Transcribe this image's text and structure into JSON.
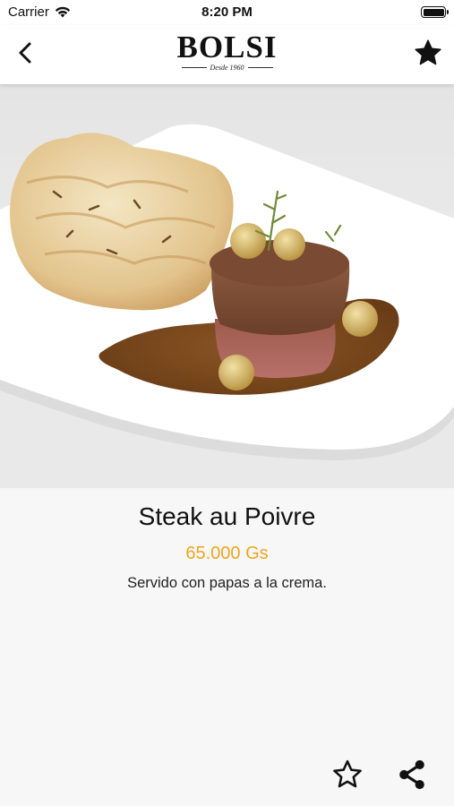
{
  "status_bar": {
    "carrier": "Carrier",
    "time": "8:20 PM",
    "icons": [
      "wifi-icon",
      "battery-icon"
    ]
  },
  "nav": {
    "back_icon": "chevron-left-icon",
    "logo_text": "BOLSI",
    "logo_subtitle": "Desde 1960",
    "favorite_icon": "star-filled-icon"
  },
  "dish": {
    "image_icon": "dish-photo",
    "name": "Steak au Poivre",
    "price": "65.000 Gs",
    "description": "Servido con papas a la crema."
  },
  "actions": {
    "favorite_icon": "star-outline-icon",
    "share_icon": "share-icon"
  },
  "colors": {
    "price": "#f0a51e",
    "nav_background": "#ffffff",
    "page_background": "#f7f7f7"
  }
}
